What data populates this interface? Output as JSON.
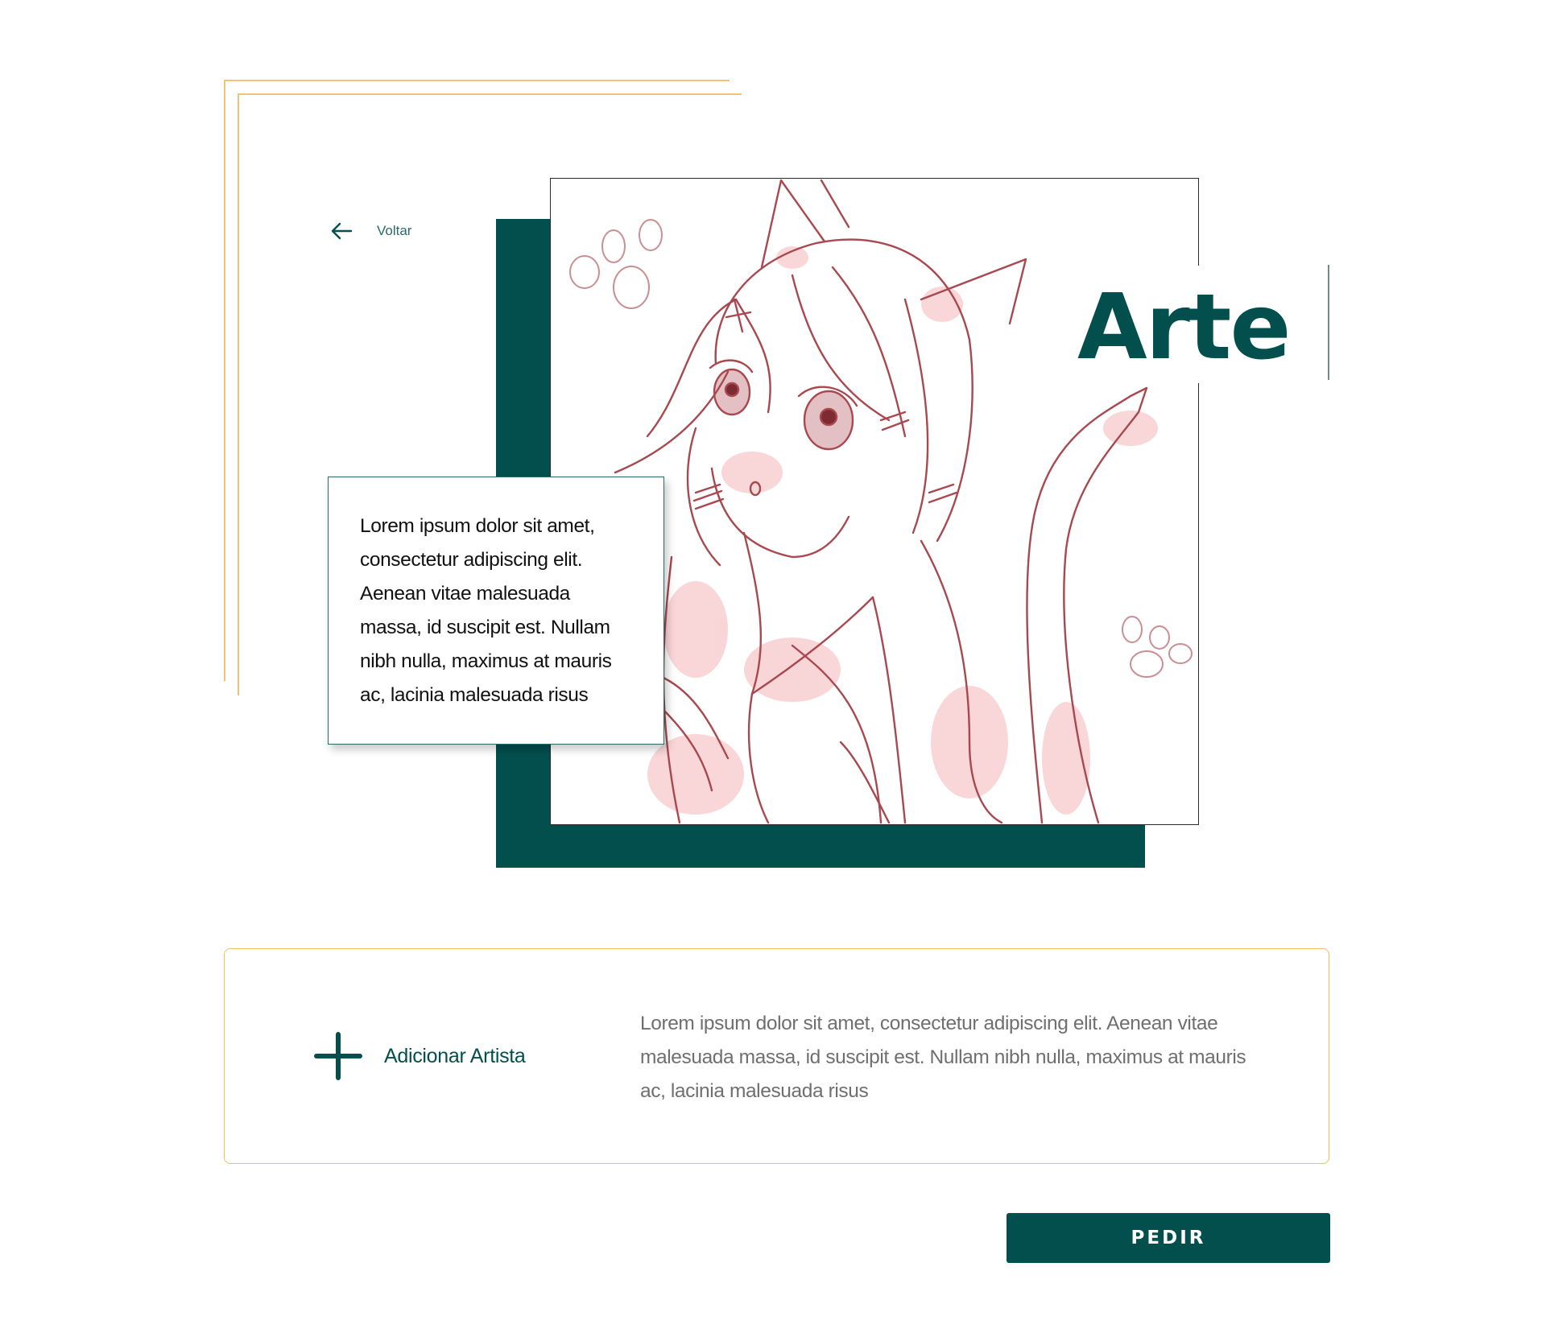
{
  "colors": {
    "primary": "#034f4e",
    "accent": "#f2c178",
    "text": "#111111",
    "muted_text": "#6f6f6f"
  },
  "nav": {
    "back_label": "Voltar",
    "back_icon": "arrow-left-icon"
  },
  "artwork": {
    "title": "Arte",
    "description": "Lorem ipsum dolor sit amet, consectetur adipiscing elit. Aenean vitae malesuada massa, id suscipit est. Nullam nibh nulla, maximus at mauris ac, lacinia malesuada risus"
  },
  "artist_panel": {
    "add_label": "Adicionar Artista",
    "add_icon": "plus-icon",
    "description": "Lorem ipsum dolor sit amet, consectetur adipiscing elit. Aenean vitae malesuada massa, id suscipit est. Nullam nibh nulla, maximus at mauris ac, lacinia malesuada risus"
  },
  "actions": {
    "order_label": "PEDIR"
  }
}
